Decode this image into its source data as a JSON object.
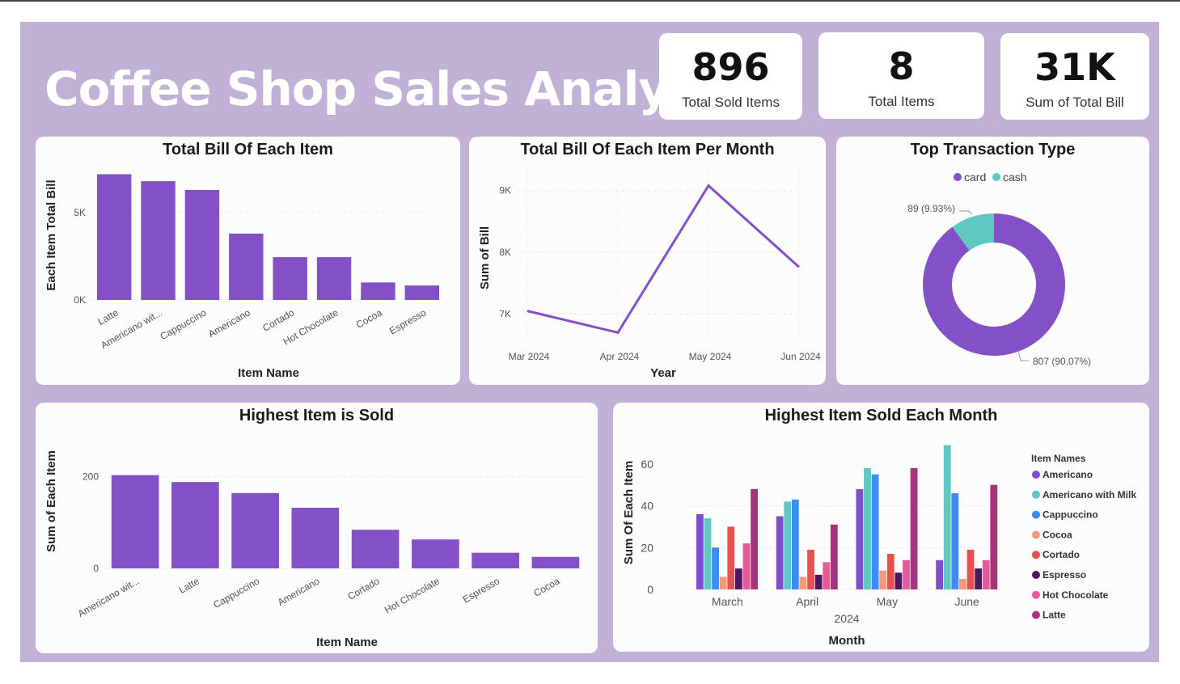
{
  "header": {
    "title": "Coffee Shop Sales Analysis"
  },
  "kpis": [
    {
      "value": "896",
      "label": "Total Sold Items"
    },
    {
      "value": "8",
      "label": "Total Items"
    },
    {
      "value": "31K",
      "label": "Sum of  Total Bill"
    }
  ],
  "colors": {
    "background": "#c0b2d6",
    "bar": "#8350c7",
    "americano": "#7e4fc9",
    "americano_milk": "#5ec9c3",
    "cappuccino": "#3d8cf6",
    "cocoa": "#f8987a",
    "cortado": "#e8504f",
    "espresso": "#4b1763",
    "hot_chocolate": "#e65a9a",
    "latte": "#a5347a"
  },
  "chart_data": [
    {
      "type": "bar",
      "title": "Total Bill Of Each Item",
      "xlabel": "Item Name",
      "ylabel": "Each Item Total Bill",
      "categories": [
        "Latte",
        "Americano wit...",
        "Cappuccino",
        "Americano",
        "Cortado",
        "Hot Chocolate",
        "Cocoa",
        "Espresso"
      ],
      "values": [
        7200,
        6800,
        6300,
        3800,
        2450,
        2450,
        1000,
        830
      ],
      "yticks": [
        {
          "value": 0,
          "label": "0K"
        },
        {
          "value": 5000,
          "label": "5K"
        }
      ],
      "ylim": [
        0,
        7500
      ],
      "grid": true
    },
    {
      "type": "line",
      "title": "Total Bill Of Each Item Per Month",
      "xlabel": "Year",
      "ylabel": "Sum of Bill",
      "categories": [
        "Mar 2024",
        "Apr 2024",
        "May 2024",
        "Jun 2024"
      ],
      "values": [
        7050,
        6700,
        9080,
        7760
      ],
      "yticks": [
        {
          "value": 7000,
          "label": "7K"
        },
        {
          "value": 8000,
          "label": "8K"
        },
        {
          "value": 9000,
          "label": "9K"
        }
      ],
      "ylim": [
        6600,
        9350
      ],
      "grid": true
    },
    {
      "type": "pie",
      "title": "Top Transaction Type",
      "legend_position": "top",
      "slices": [
        {
          "name": "card",
          "value": 807,
          "label": "807 (90.07%)"
        },
        {
          "name": "cash",
          "value": 89,
          "label": "89 (9.93%)"
        }
      ]
    },
    {
      "type": "bar",
      "title": "Highest Item is Sold",
      "xlabel": "Item Name",
      "ylabel": "Sum of Each Item",
      "categories": [
        "Americano wit...",
        "Latte",
        "Cappuccino",
        "Americano",
        "Cortado",
        "Hot Chocolate",
        "Espresso",
        "Cocoa"
      ],
      "values": [
        203,
        188,
        164,
        132,
        84,
        63,
        34,
        25
      ],
      "yticks": [
        {
          "value": 0,
          "label": "0"
        },
        {
          "value": 200,
          "label": "200"
        }
      ],
      "ylim": [
        0,
        220
      ],
      "grid": true
    },
    {
      "type": "bar",
      "title": "Highest Item Sold Each Month",
      "xlabel": "Month",
      "xgroup_label": "2024",
      "ylabel": "Sum Of Each Item",
      "legend_title": "Item Names",
      "legend_position": "right",
      "categories": [
        "March",
        "April",
        "May",
        "June"
      ],
      "series": [
        {
          "name": "Americano",
          "values": [
            36,
            35,
            48,
            14
          ]
        },
        {
          "name": "Americano with Milk",
          "values": [
            34,
            42,
            58,
            69
          ]
        },
        {
          "name": "Cappuccino",
          "values": [
            20,
            43,
            55,
            46
          ]
        },
        {
          "name": "Cocoa",
          "values": [
            6,
            6,
            9,
            5
          ]
        },
        {
          "name": "Cortado",
          "values": [
            30,
            19,
            17,
            19
          ]
        },
        {
          "name": "Espresso",
          "values": [
            10,
            7,
            8,
            10
          ]
        },
        {
          "name": "Hot Chocolate",
          "values": [
            22,
            13,
            14,
            14
          ]
        },
        {
          "name": "Latte",
          "values": [
            48,
            31,
            58,
            50
          ]
        }
      ],
      "yticks": [
        {
          "value": 0,
          "label": "0"
        },
        {
          "value": 20,
          "label": "20"
        },
        {
          "value": 40,
          "label": "40"
        },
        {
          "value": 60,
          "label": "60"
        }
      ],
      "ylim": [
        0,
        70
      ],
      "grid": true
    }
  ]
}
